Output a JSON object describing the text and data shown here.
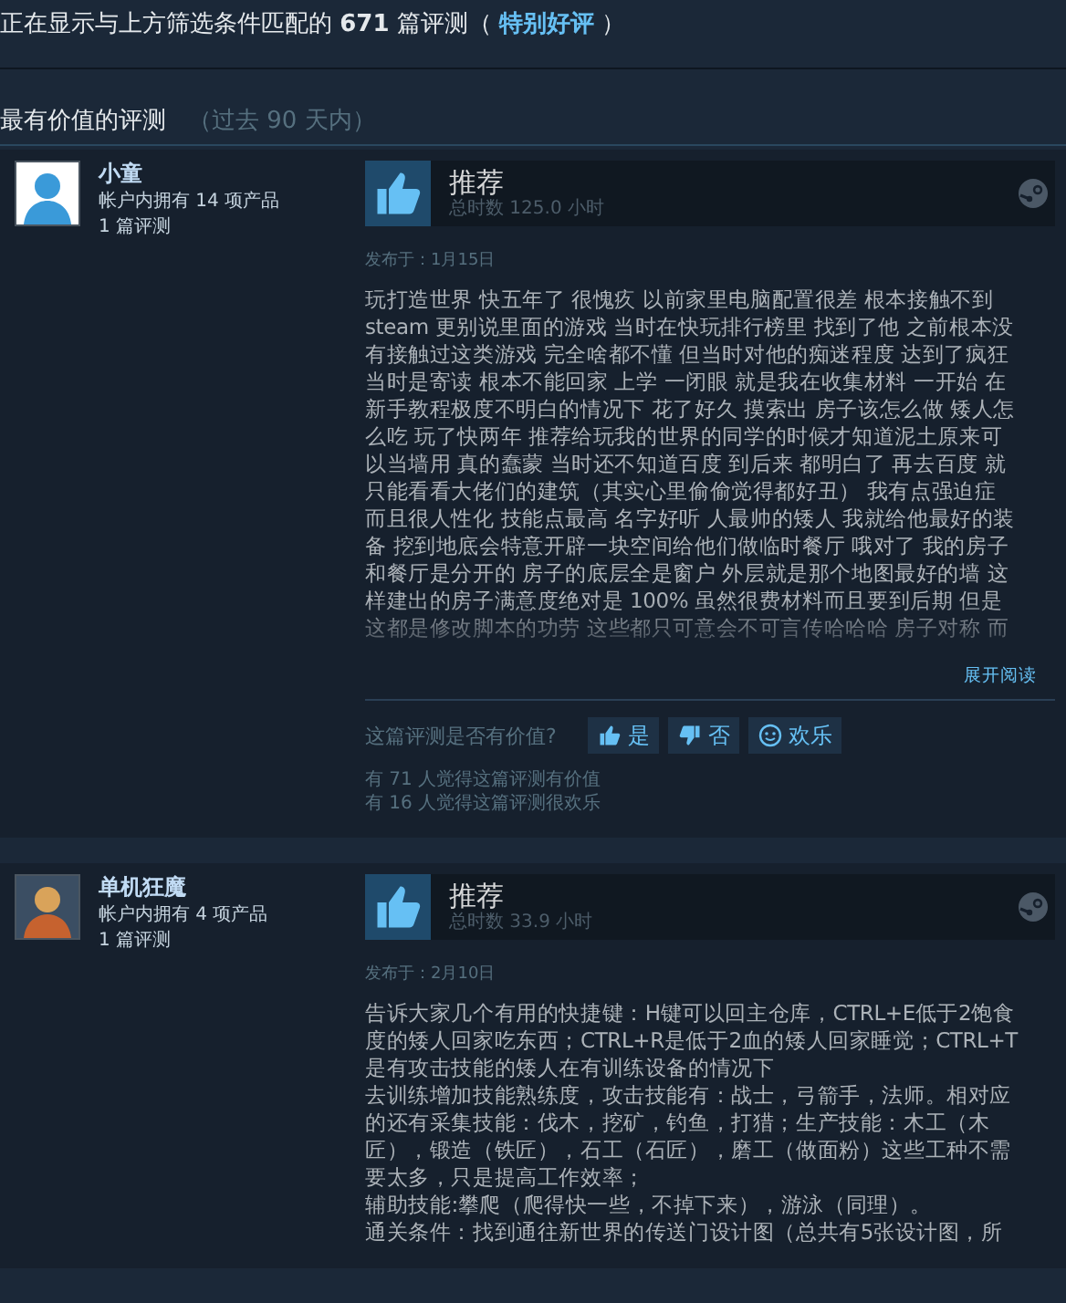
{
  "summary": {
    "prefix": "正在显示与上方筛选条件匹配的 **671** 篇评测（ ",
    "rating": "特别好评",
    "suffix": " ）"
  },
  "section": {
    "title": "最有价值的评测",
    "subtitle": "（过去 90 天内）"
  },
  "reviews": [
    {
      "author": "小童",
      "products": "帐户内拥有 14 项产品",
      "review_count": "1 篇评测",
      "recommended": true,
      "verdict": "推荐",
      "hours": "总时数 125.0 小时",
      "date": "发布于：1月15日",
      "faded": true,
      "paragraphs": [
        [
          "玩打造世界 快五年了 很愧疚 以前家里电脑配置很差 根本接触不到",
          "steam 更别说里面的游戏 当时在快玩排行榜里 找到了他 之前根本没",
          "有接触过这类游戏 完全啥都不懂 但当时对他的痴迷程度 达到了疯狂",
          "当时是寄读 根本不能回家 上学 一闭眼 就是我在收集材料 一开始 在",
          "新手教程极度不明白的情况下 花了好久 摸索出 房子该怎么做 矮人怎",
          "么吃 玩了快两年 推荐给玩我的世界的同学的时候才知道泥土原来可",
          "以当墙用 真的蠢蒙 当时还不知道百度 到后来 都明白了 再去百度 就",
          "只能看看大佬们的建筑（其实心里偷偷觉得都好丑） 我有点强迫症",
          "而且很人性化 技能点最高 名字好听 人最帅的矮人 我就给他最好的装",
          "备 挖到地底会特意开辟一块空间给他们做临时餐厅 哦对了 我的房子",
          "和餐厅是分开的 房子的底层全是窗户 外层就是那个地图最好的墙 这",
          "样建出的房子满意度绝对是 100% 虽然很费材料而且要到后期 但是",
          "这都是修改脚本的功劳 这些都只可意会不可言传哈哈哈 房子对称 而"
        ]
      ],
      "expand": "展开阅读",
      "helpful_prompt": "这篇评测是否有价值?",
      "votes": [
        {
          "kind": "up",
          "label": "是"
        },
        {
          "kind": "down",
          "label": "否"
        },
        {
          "kind": "funny",
          "label": "欢乐"
        }
      ],
      "counts": [
        "有 71 人觉得这篇评测有价值",
        "有 16 人觉得这篇评测很欢乐"
      ]
    },
    {
      "author": "单机狂魔",
      "products": "帐户内拥有 4 项产品",
      "review_count": "1 篇评测",
      "recommended": true,
      "verdict": "推荐",
      "hours": "总时数 33.9 小时",
      "date": "发布于：2月10日",
      "paragraphs": [
        [
          "告诉大家几个有用的快捷键：H键可以回主仓库，CTRL+E低于2饱食",
          "度的矮人回家吃东西；CTRL+R是低于2血的矮人回家睡觉；CTRL+T",
          "是有攻击技能的矮人在有训练设备的情况下"
        ],
        [
          "去训练增加技能熟练度，攻击技能有：战士，弓箭手，法师。相对应",
          "的还有采集技能：伐木，挖矿，钓鱼，打猎；生产技能：木工（木",
          "匠），锻造（铁匠），石工（石匠），磨工（做面粉）这些工种不需",
          "要太多，只是提高工作效率；"
        ],
        [
          "辅助技能:攀爬（爬得快一些，不掉下来），游泳（同理）。"
        ],
        [
          "通关条件：找到通往新世界的传送门设计图（总共有5张设计图，所"
        ]
      ]
    }
  ]
}
